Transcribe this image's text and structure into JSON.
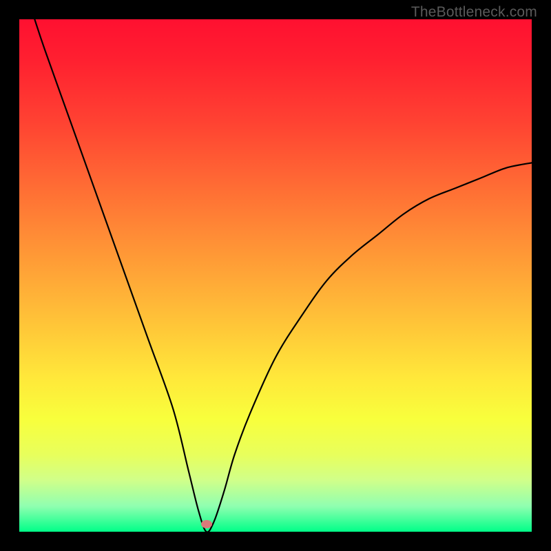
{
  "watermark": "TheBottleneck.com",
  "chart_data": {
    "type": "line",
    "title": "",
    "xlabel": "",
    "ylabel": "",
    "xlim": [
      0,
      100
    ],
    "ylim": [
      0,
      100
    ],
    "background_gradient": {
      "top": "#ff1030",
      "bottom": "#00ff88",
      "meaning": "high (red) to low (green) bottleneck"
    },
    "series": [
      {
        "name": "bottleneck-curve",
        "x": [
          3,
          5,
          10,
          15,
          20,
          25,
          30,
          33,
          35,
          36.5,
          38,
          40,
          42,
          45,
          50,
          55,
          60,
          65,
          70,
          75,
          80,
          85,
          90,
          95,
          100
        ],
        "values": [
          100,
          94,
          80,
          66,
          52,
          38,
          24,
          12,
          4,
          0,
          2,
          8,
          15,
          23,
          34,
          42,
          49,
          54,
          58,
          62,
          65,
          67,
          69,
          71,
          72
        ]
      }
    ],
    "marker": {
      "x": 36.5,
      "y": 1.5,
      "color": "#d97a7a"
    }
  }
}
